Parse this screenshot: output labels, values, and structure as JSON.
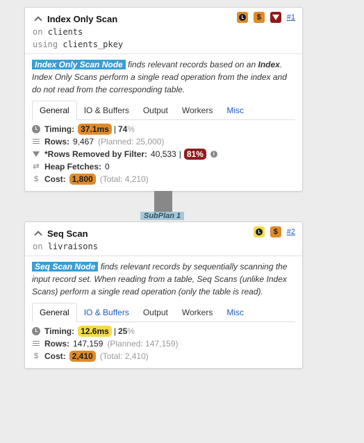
{
  "colors": {
    "timing_orange": "#e08b2a",
    "timing_yellow": "#f6da4b",
    "filter_red": "#8f1c1c",
    "node_highlight": "#3a9ed3",
    "link": "#1a5cc0"
  },
  "subplan_label": "SubPlan 1",
  "nodes": [
    {
      "title": "Index Only Scan",
      "on_kw": "on",
      "relation": "clients",
      "using_kw": "using",
      "index": "clients_pkey",
      "node_id": "#1",
      "badges": [
        "clock-icon",
        "dollar-icon",
        "filter-icon"
      ],
      "desc_node": "Index Only Scan Node",
      "desc_text_1": " finds relevant records based on an ",
      "desc_bold": "Index",
      "desc_text_2": ". Index Only Scans perform a single read operation from the index and do not read from the corresponding table.",
      "tabs": [
        "General",
        "IO & Buffers",
        "Output",
        "Workers",
        "Misc"
      ],
      "timing_label": "Timing:",
      "timing_value": "37.1ms",
      "timing_sep": "|",
      "timing_pct": "74",
      "pct_sign": "%",
      "rows_label": "Rows:",
      "rows_value": "9,467",
      "rows_planned": "(Planned: 25,000)",
      "removed_label": "*Rows Removed by Filter:",
      "removed_value": "40,533",
      "removed_sep": "|",
      "removed_pct": "81%",
      "heap_label": "Heap Fetches:",
      "heap_value": "0",
      "cost_label": "Cost:",
      "cost_value": "1,800",
      "cost_total": "(Total: 4,210)"
    },
    {
      "title": "Seq Scan",
      "on_kw": "on",
      "relation": "livraisons",
      "node_id": "#2",
      "badges": [
        "clock-icon",
        "dollar-icon"
      ],
      "desc_node": "Seq Scan Node",
      "desc_text": " finds relevant records by sequentially scanning the input record set. When reading from a table, Seq Scans (unlike Index Scans) perform a single read operation (only the table is read).",
      "tabs": [
        "General",
        "IO & Buffers",
        "Output",
        "Workers",
        "Misc"
      ],
      "timing_label": "Timing:",
      "timing_value": "12.6ms",
      "timing_sep": "|",
      "timing_pct": "25",
      "pct_sign": "%",
      "rows_label": "Rows:",
      "rows_value": "147,159",
      "rows_planned": "(Planned: 147,159)",
      "cost_label": "Cost:",
      "cost_value": "2,410",
      "cost_total": "(Total: 2,410)"
    }
  ]
}
